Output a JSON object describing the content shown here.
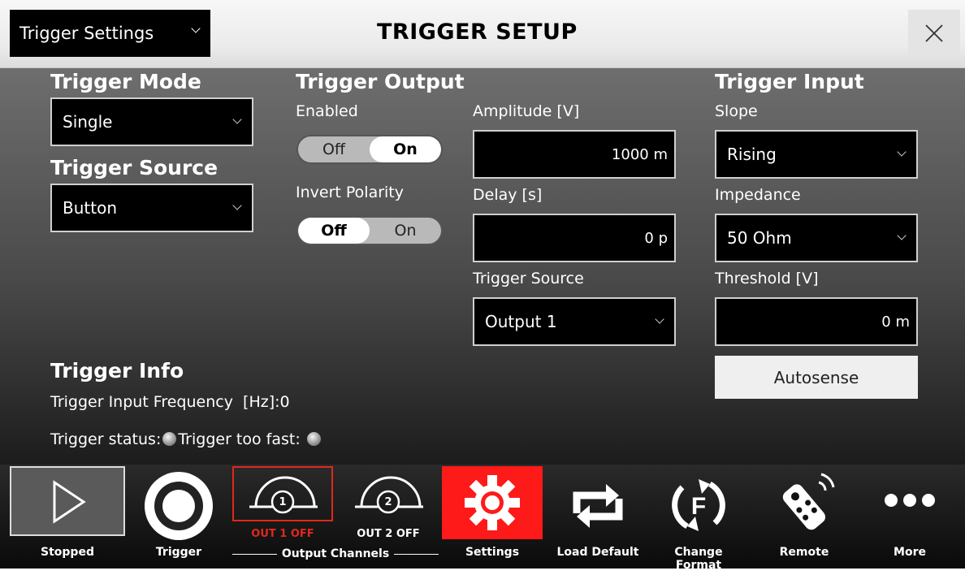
{
  "window": {
    "menu_label": "Trigger Settings",
    "title": "TRIGGER SETUP"
  },
  "trigger_mode": {
    "heading": "Trigger Mode",
    "value": "Single"
  },
  "trigger_source": {
    "heading": "Trigger Source",
    "value": "Button"
  },
  "trigger_output": {
    "heading": "Trigger Output",
    "enabled_label": "Enabled",
    "enabled_off": "Off",
    "enabled_on": "On",
    "enabled_state": "On",
    "invert_label": "Invert Polarity",
    "invert_off": "Off",
    "invert_on": "On",
    "invert_state": "Off",
    "amplitude_label": "Amplitude [V]",
    "amplitude_value": "1000 m",
    "delay_label": "Delay [s]",
    "delay_value": "0 p",
    "source_label": "Trigger Source",
    "source_value": "Output 1"
  },
  "trigger_input": {
    "heading": "Trigger Input",
    "slope_label": "Slope",
    "slope_value": "Rising",
    "impedance_label": "Impedance",
    "impedance_value": "50 Ohm",
    "threshold_label": "Threshold [V]",
    "threshold_value": "0 m",
    "autosense_label": "Autosense"
  },
  "trigger_info": {
    "heading": "Trigger Info",
    "freq_text": "Trigger Input Frequency  [Hz]:",
    "freq_value": "0",
    "status_label": "Trigger status:",
    "too_fast_label": "Trigger too fast:"
  },
  "toolbar": {
    "stopped": "Stopped",
    "trigger": "Trigger",
    "out1_status": "OUT 1 OFF",
    "out2_status": "OUT 2 OFF",
    "ch1_num": "1",
    "ch2_num": "2",
    "output_channels": "Output Channels",
    "settings": "Settings",
    "load_default": "Load Default",
    "change_format": "Change Format",
    "remote": "Remote",
    "more": "More"
  },
  "colors": {
    "accent_red": "#ff1a1a",
    "out1_red": "#e0281e"
  }
}
